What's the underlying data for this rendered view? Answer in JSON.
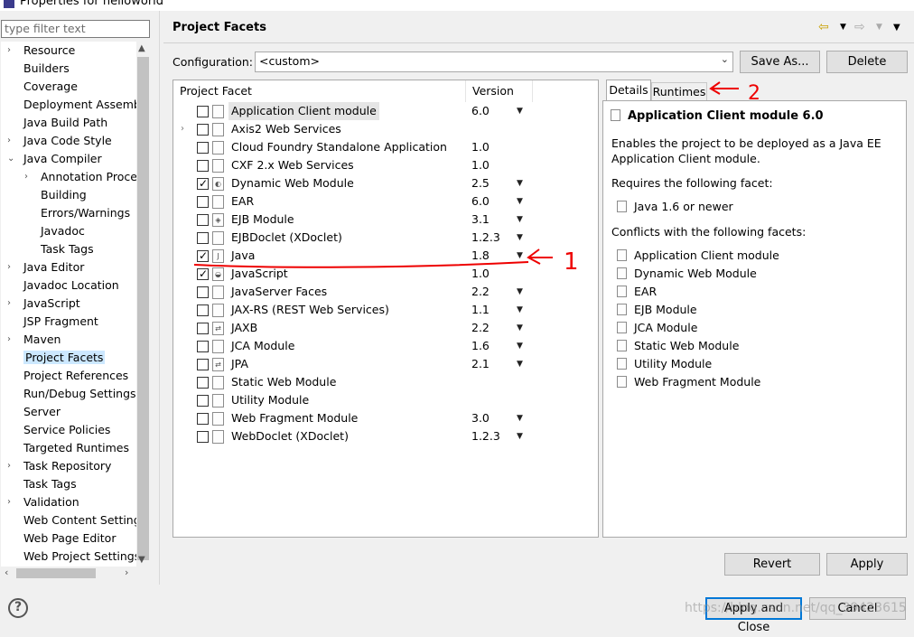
{
  "window": {
    "title": "Properties for helloworld"
  },
  "nav": {
    "filter_placeholder": "type filter text",
    "items": [
      {
        "label": "Resource",
        "tw": "›",
        "indent": 0
      },
      {
        "label": "Builders",
        "tw": "",
        "indent": 0
      },
      {
        "label": "Coverage",
        "tw": "",
        "indent": 0
      },
      {
        "label": "Deployment Assembly",
        "tw": "",
        "indent": 0
      },
      {
        "label": "Java Build Path",
        "tw": "",
        "indent": 0
      },
      {
        "label": "Java Code Style",
        "tw": "›",
        "indent": 0
      },
      {
        "label": "Java Compiler",
        "tw": "⌄",
        "indent": 0
      },
      {
        "label": "Annotation Processing",
        "tw": "›",
        "indent": 1
      },
      {
        "label": "Building",
        "tw": "",
        "indent": 1
      },
      {
        "label": "Errors/Warnings",
        "tw": "",
        "indent": 1
      },
      {
        "label": "Javadoc",
        "tw": "",
        "indent": 1
      },
      {
        "label": "Task Tags",
        "tw": "",
        "indent": 1
      },
      {
        "label": "Java Editor",
        "tw": "›",
        "indent": 0
      },
      {
        "label": "Javadoc Location",
        "tw": "",
        "indent": 0
      },
      {
        "label": "JavaScript",
        "tw": "›",
        "indent": 0
      },
      {
        "label": "JSP Fragment",
        "tw": "",
        "indent": 0
      },
      {
        "label": "Maven",
        "tw": "›",
        "indent": 0
      },
      {
        "label": "Project Facets",
        "tw": "",
        "indent": 0,
        "selected": true
      },
      {
        "label": "Project References",
        "tw": "",
        "indent": 0
      },
      {
        "label": "Run/Debug Settings",
        "tw": "",
        "indent": 0
      },
      {
        "label": "Server",
        "tw": "",
        "indent": 0
      },
      {
        "label": "Service Policies",
        "tw": "",
        "indent": 0
      },
      {
        "label": "Targeted Runtimes",
        "tw": "",
        "indent": 0
      },
      {
        "label": "Task Repository",
        "tw": "›",
        "indent": 0
      },
      {
        "label": "Task Tags",
        "tw": "",
        "indent": 0
      },
      {
        "label": "Validation",
        "tw": "›",
        "indent": 0
      },
      {
        "label": "Web Content Settings",
        "tw": "",
        "indent": 0
      },
      {
        "label": "Web Page Editor",
        "tw": "",
        "indent": 0
      },
      {
        "label": "Web Project Settings",
        "tw": "",
        "indent": 0
      }
    ]
  },
  "header": {
    "title": "Project Facets",
    "back_icon": "back-arrow-icon",
    "forward_icon": "forward-arrow-icon",
    "menu_icon": "view-menu-icon"
  },
  "config": {
    "label": "Configuration:",
    "value": "<custom>",
    "save_as": "Save As...",
    "delete": "Delete"
  },
  "facets": {
    "col_facet": "Project Facet",
    "col_version": "Version",
    "rows": [
      {
        "name": "Application Client module",
        "version": "6.0",
        "checked": false,
        "dropdown": true,
        "selected": true,
        "expand": false,
        "icon": "page-icon"
      },
      {
        "name": "Axis2 Web Services",
        "version": "",
        "checked": false,
        "dropdown": false,
        "expand": true,
        "icon": "page-icon"
      },
      {
        "name": "Cloud Foundry Standalone Application",
        "version": "1.0",
        "checked": false,
        "dropdown": false,
        "icon": "page-icon"
      },
      {
        "name": "CXF 2.x Web Services",
        "version": "1.0",
        "checked": false,
        "dropdown": false,
        "icon": "page-icon"
      },
      {
        "name": "Dynamic Web Module",
        "version": "2.5",
        "checked": true,
        "dropdown": true,
        "icon": "globe-page-icon"
      },
      {
        "name": "EAR",
        "version": "6.0",
        "checked": false,
        "dropdown": true,
        "icon": "page-icon"
      },
      {
        "name": "EJB Module",
        "version": "3.1",
        "checked": false,
        "dropdown": true,
        "icon": "bean-icon"
      },
      {
        "name": "EJBDoclet (XDoclet)",
        "version": "1.2.3",
        "checked": false,
        "dropdown": true,
        "icon": "page-icon"
      },
      {
        "name": "Java",
        "version": "1.8",
        "checked": true,
        "dropdown": true,
        "icon": "java-icon"
      },
      {
        "name": "JavaScript",
        "version": "1.0",
        "checked": true,
        "dropdown": false,
        "icon": "js-icon"
      },
      {
        "name": "JavaServer Faces",
        "version": "2.2",
        "checked": false,
        "dropdown": true,
        "icon": "page-icon"
      },
      {
        "name": "JAX-RS (REST Web Services)",
        "version": "1.1",
        "checked": false,
        "dropdown": true,
        "icon": "page-icon"
      },
      {
        "name": "JAXB",
        "version": "2.2",
        "checked": false,
        "dropdown": true,
        "icon": "xml-arrows-icon"
      },
      {
        "name": "JCA Module",
        "version": "1.6",
        "checked": false,
        "dropdown": true,
        "icon": "page-icon"
      },
      {
        "name": "JPA",
        "version": "2.1",
        "checked": false,
        "dropdown": true,
        "icon": "xml-arrows-icon"
      },
      {
        "name": "Static Web Module",
        "version": "",
        "checked": false,
        "dropdown": false,
        "icon": "page-icon"
      },
      {
        "name": "Utility Module",
        "version": "",
        "checked": false,
        "dropdown": false,
        "icon": "page-icon"
      },
      {
        "name": "Web Fragment Module",
        "version": "3.0",
        "checked": false,
        "dropdown": true,
        "icon": "page-icon"
      },
      {
        "name": "WebDoclet (XDoclet)",
        "version": "1.2.3",
        "checked": false,
        "dropdown": true,
        "icon": "page-icon"
      }
    ]
  },
  "details": {
    "tab_details": "Details",
    "tab_runtimes": "Runtimes",
    "title": "Application Client module 6.0",
    "description": "Enables the project to be deployed as a Java EE Application Client module.",
    "requires_label": "Requires the following facet:",
    "requires": [
      "Java 1.6 or newer"
    ],
    "conflicts_label": "Conflicts with the following facets:",
    "conflicts": [
      "Application Client module",
      "Dynamic Web Module",
      "EAR",
      "EJB Module",
      "JCA Module",
      "Static Web Module",
      "Utility Module",
      "Web Fragment Module"
    ]
  },
  "actions": {
    "revert": "Revert",
    "apply": "Apply",
    "apply_close": "Apply and Close",
    "cancel": "Cancel",
    "help_icon": "help-icon"
  },
  "annotations": {
    "mark1": "1",
    "mark2": "2"
  },
  "watermark": "https://blog.csdn.net/qq_39423615"
}
